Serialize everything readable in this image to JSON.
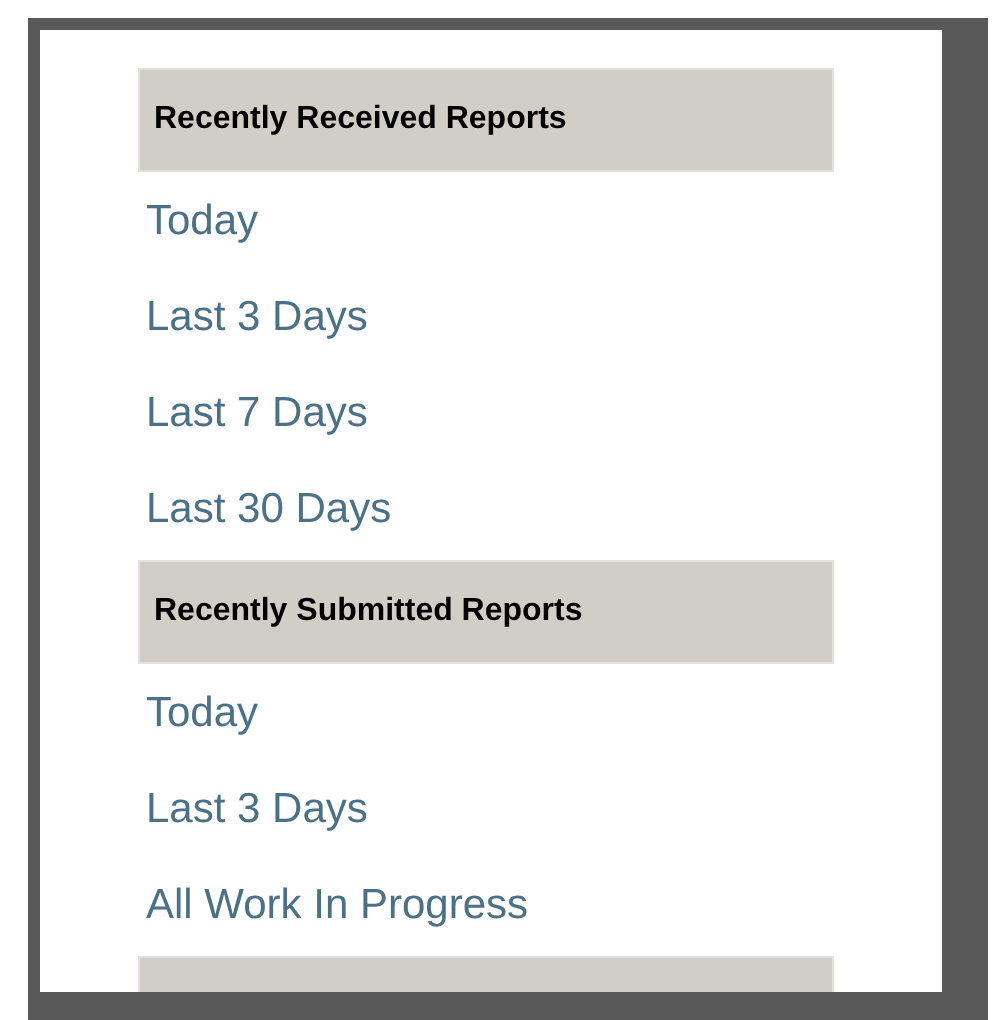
{
  "sections": [
    {
      "heading": "Recently Received Reports",
      "links": [
        "Today",
        "Last 3 Days",
        "Last 7 Days",
        "Last 30 Days"
      ]
    },
    {
      "heading": "Recently Submitted Reports",
      "links": [
        "Today",
        "Last 3 Days",
        "All Work In Progress"
      ]
    }
  ]
}
